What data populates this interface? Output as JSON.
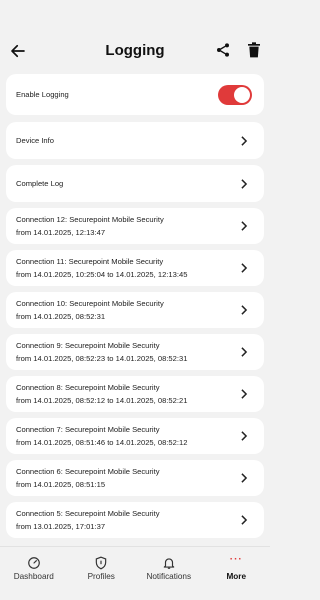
{
  "header": {
    "title": "Logging"
  },
  "settings": {
    "enable_logging_label": "Enable Logging",
    "enable_logging_on": true,
    "device_info_label": "Device Info",
    "complete_log_label": "Complete Log"
  },
  "connections": [
    {
      "title": "Connection 12: Securepoint Mobile Security",
      "range": "from 14.01.2025, 12:13:47"
    },
    {
      "title": "Connection 11: Securepoint Mobile Security",
      "range": "from 14.01.2025, 10:25:04 to 14.01.2025, 12:13:45"
    },
    {
      "title": "Connection 10: Securepoint Mobile Security",
      "range": "from 14.01.2025, 08:52:31"
    },
    {
      "title": "Connection 9: Securepoint Mobile Security",
      "range": "from 14.01.2025, 08:52:23 to 14.01.2025, 08:52:31"
    },
    {
      "title": "Connection 8: Securepoint Mobile Security",
      "range": "from 14.01.2025, 08:52:12 to 14.01.2025, 08:52:21"
    },
    {
      "title": "Connection 7: Securepoint Mobile Security",
      "range": "from 14.01.2025, 08:51:46 to 14.01.2025, 08:52:12"
    },
    {
      "title": "Connection 6: Securepoint Mobile Security",
      "range": "from 14.01.2025, 08:51:15"
    },
    {
      "title": "Connection 5: Securepoint Mobile Security",
      "range": "from 13.01.2025, 17:01:37"
    }
  ],
  "tabbar": {
    "dashboard": "Dashboard",
    "profiles": "Profiles",
    "notifications": "Notifications",
    "more": "More",
    "more_dots": "···",
    "accent": "#e03a3a"
  }
}
